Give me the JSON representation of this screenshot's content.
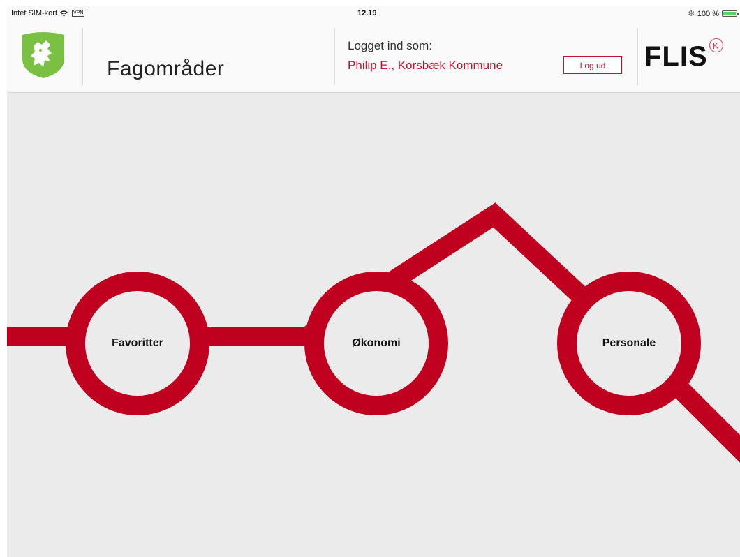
{
  "status_bar": {
    "carrier": "Intet SIM-kort",
    "vpn": "VPN",
    "time": "12.19",
    "bluetooth": "✻",
    "battery": "100 %",
    "battery_level": 1.0
  },
  "header": {
    "title": "Fagområder",
    "logged_in_label": "Logget ind som:",
    "user": "Philip E., Korsbæk Kommune",
    "logout_label": "Log ud",
    "brand": "FLIS",
    "brand_mark": "K"
  },
  "main": {
    "nodes": [
      {
        "label": "Favoritter"
      },
      {
        "label": "Økonomi"
      },
      {
        "label": "Personale"
      }
    ]
  },
  "colors": {
    "accent": "#c0001f",
    "crest": "#7ac143",
    "background": "#ebebeb",
    "text_accent": "#c8102e"
  },
  "icons": {
    "crest": "lion-crest-icon",
    "wifi": "wifi-icon",
    "bluetooth": "bluetooth-icon",
    "battery": "battery-icon"
  }
}
